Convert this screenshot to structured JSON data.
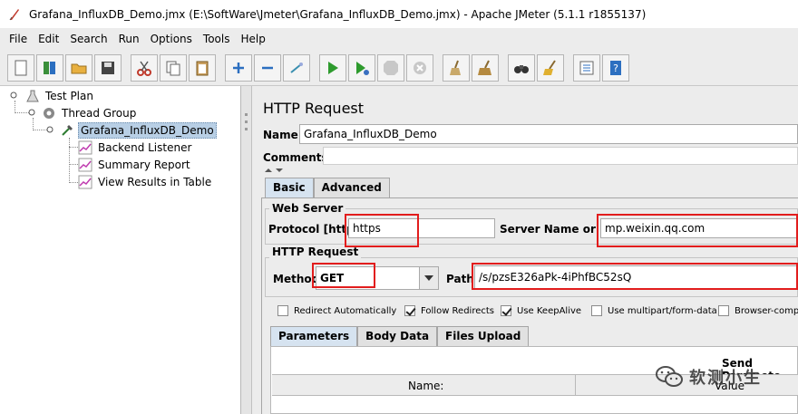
{
  "window": {
    "title": "Grafana_InfluxDB_Demo.jmx (E:\\SoftWare\\Jmeter\\Grafana_InfluxDB_Demo.jmx) - Apache JMeter (5.1.1 r1855137)"
  },
  "menu": {
    "items": [
      {
        "label": "File"
      },
      {
        "label": "Edit"
      },
      {
        "label": "Search"
      },
      {
        "label": "Run"
      },
      {
        "label": "Options"
      },
      {
        "label": "Tools"
      },
      {
        "label": "Help"
      }
    ]
  },
  "tree": {
    "items": [
      {
        "label": "Test Plan"
      },
      {
        "label": "Thread Group"
      },
      {
        "label": "Grafana_InfluxDB_Demo"
      },
      {
        "label": "Backend Listener"
      },
      {
        "label": "Summary Report"
      },
      {
        "label": "View Results in Table"
      }
    ]
  },
  "panel": {
    "title": "HTTP Request",
    "name_label": "Name:",
    "name_value": "Grafana_InfluxDB_Demo",
    "comments_label": "Comments:",
    "tabs": [
      {
        "label": "Basic"
      },
      {
        "label": "Advanced"
      }
    ],
    "web_server": {
      "title": "Web Server",
      "protocol_label": "Protocol [http]:",
      "protocol_value": "https",
      "server_label": "Server Name or IP:",
      "server_value": "mp.weixin.qq.com"
    },
    "http_request": {
      "title": "HTTP Request",
      "method_label": "Method:",
      "method_value": "GET",
      "path_label": "Path:",
      "path_value": "/s/pzsE326aPk-4iPhfBC52sQ"
    },
    "checkboxes": [
      {
        "label": "Redirect Automatically",
        "checked": false
      },
      {
        "label": "Follow Redirects",
        "checked": true
      },
      {
        "label": "Use KeepAlive",
        "checked": true
      },
      {
        "label": "Use multipart/form-data",
        "checked": false
      },
      {
        "label": "Browser-compa",
        "checked": false
      }
    ],
    "sub_tabs": [
      {
        "label": "Parameters"
      },
      {
        "label": "Body Data"
      },
      {
        "label": "Files Upload"
      }
    ],
    "params_header": "Send Paramete",
    "col_name": "Name:",
    "col_value": "Value"
  },
  "watermark": {
    "text": "软测小生"
  },
  "colors": {
    "highlight": "#e21d1d",
    "selected_tab": "#d6e3f0",
    "tree_selection": "#b8cfe5"
  }
}
